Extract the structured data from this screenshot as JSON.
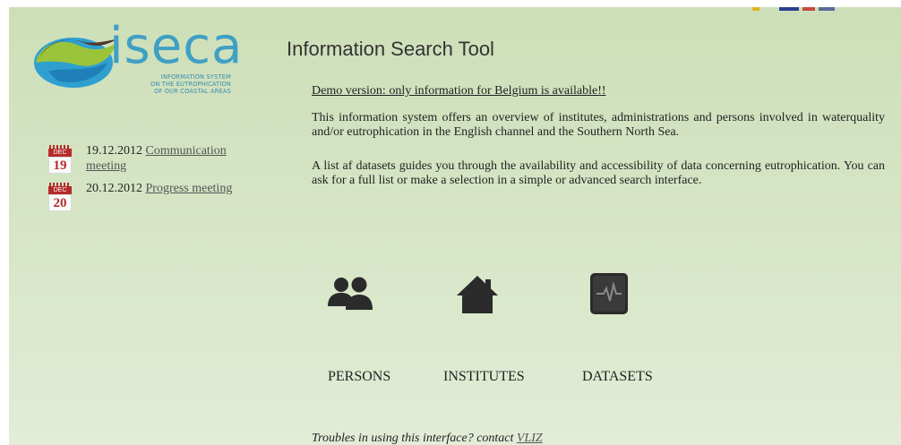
{
  "logo": {
    "word": "iseca",
    "subtitle_lines": [
      "INFORMATION SYSTEM",
      "ON THE EUTROPHICATION",
      "OF OUR COASTAL AREAS"
    ]
  },
  "news": [
    {
      "month": "DEC",
      "day": "19",
      "date": "19.12.2012",
      "link": "Communication meeting"
    },
    {
      "month": "DEC",
      "day": "20",
      "date": "20.12.2012",
      "link": "Progress meeting"
    }
  ],
  "page_title": "Information Search Tool",
  "demo_notice": "Demo version: only information for Belgium is available!!",
  "paragraphs": [
    "This information system offers an overview of institutes, administrations and persons involved in waterquality and/or eutrophication in the English channel and the Southern North Sea.",
    "A list af datasets guides you through the  availability and accessibility of data concerning eutrophication. You can ask for a full list or make a selection in a simple or advanced search interface."
  ],
  "tiles": [
    {
      "label": "PERSONS",
      "icon": "persons-icon"
    },
    {
      "label": "INSTITUTES",
      "icon": "house-icon"
    },
    {
      "label": "DATASETS",
      "icon": "pulse-chart-icon"
    }
  ],
  "footer": {
    "text": "Troubles in using this interface? contact ",
    "link": "VLIZ"
  },
  "colors": {
    "accent_blue": "#3fa0c4",
    "calendar_red": "#b52a2a",
    "background": "#d4e3c2"
  }
}
